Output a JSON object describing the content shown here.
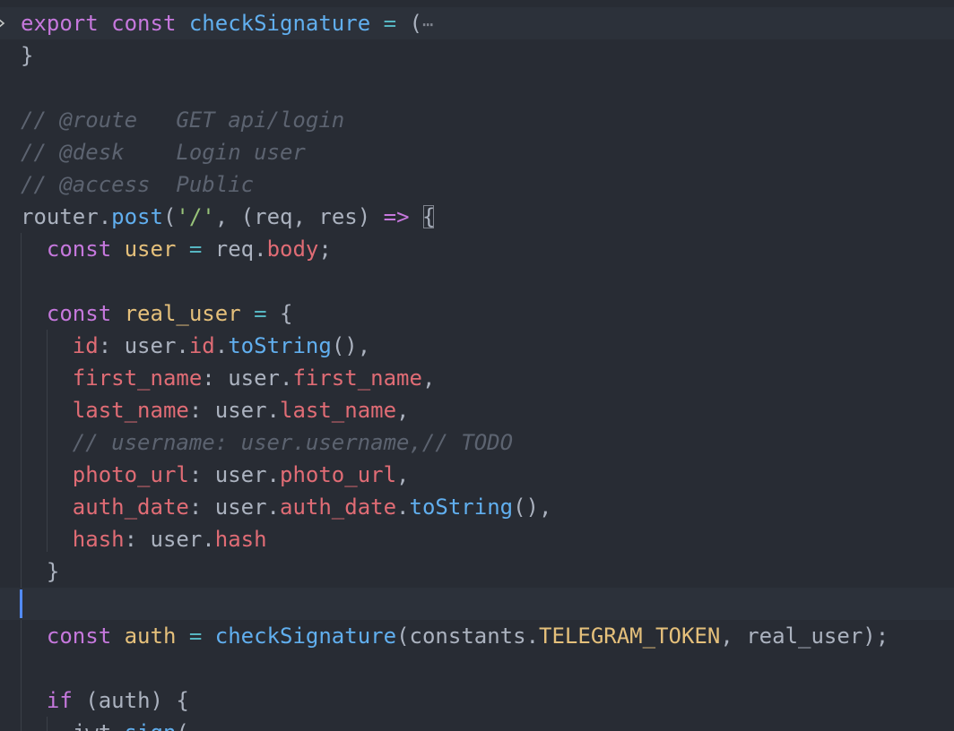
{
  "editor": {
    "lines": [
      {
        "tokens": [
          {
            "t": "export",
            "c": "kw"
          },
          {
            "t": " ",
            "c": "pn"
          },
          {
            "t": "const",
            "c": "kw"
          },
          {
            "t": " ",
            "c": "pn"
          },
          {
            "t": "checkSignature",
            "c": "fn"
          },
          {
            "t": " ",
            "c": "pn"
          },
          {
            "t": "=",
            "c": "op"
          },
          {
            "t": " (",
            "c": "pn"
          }
        ],
        "folded": true
      },
      {
        "tokens": [
          {
            "t": "}",
            "c": "pn"
          }
        ]
      },
      {
        "tokens": []
      },
      {
        "tokens": [
          {
            "t": "// @route   GET api/login",
            "c": "cm"
          }
        ]
      },
      {
        "tokens": [
          {
            "t": "// @desk    Login user",
            "c": "cm"
          }
        ]
      },
      {
        "tokens": [
          {
            "t": "// @access  Public",
            "c": "cm"
          }
        ]
      },
      {
        "tokens": [
          {
            "t": "router",
            "c": "plain"
          },
          {
            "t": ".",
            "c": "pn"
          },
          {
            "t": "post",
            "c": "fn"
          },
          {
            "t": "(",
            "c": "pn"
          },
          {
            "t": "'/'",
            "c": "str"
          },
          {
            "t": ", (",
            "c": "pn"
          },
          {
            "t": "req",
            "c": "plain"
          },
          {
            "t": ", ",
            "c": "pn"
          },
          {
            "t": "res",
            "c": "plain"
          },
          {
            "t": ") ",
            "c": "pn"
          },
          {
            "t": "=>",
            "c": "kw"
          },
          {
            "t": " ",
            "c": "pn"
          },
          {
            "t": "{",
            "c": "pn",
            "match": true
          }
        ]
      },
      {
        "tokens": [
          {
            "t": "  ",
            "c": "pn"
          },
          {
            "t": "const",
            "c": "kw"
          },
          {
            "t": " ",
            "c": "pn"
          },
          {
            "t": "user",
            "c": "var"
          },
          {
            "t": " ",
            "c": "pn"
          },
          {
            "t": "=",
            "c": "op"
          },
          {
            "t": " ",
            "c": "pn"
          },
          {
            "t": "req",
            "c": "plain"
          },
          {
            "t": ".",
            "c": "pn"
          },
          {
            "t": "body",
            "c": "prop"
          },
          {
            "t": ";",
            "c": "pn"
          }
        ]
      },
      {
        "tokens": []
      },
      {
        "tokens": [
          {
            "t": "  ",
            "c": "pn"
          },
          {
            "t": "const",
            "c": "kw"
          },
          {
            "t": " ",
            "c": "pn"
          },
          {
            "t": "real_user",
            "c": "var"
          },
          {
            "t": " ",
            "c": "pn"
          },
          {
            "t": "=",
            "c": "op"
          },
          {
            "t": " {",
            "c": "pn"
          }
        ]
      },
      {
        "tokens": [
          {
            "t": "    ",
            "c": "pn"
          },
          {
            "t": "id",
            "c": "prop"
          },
          {
            "t": ": ",
            "c": "pn"
          },
          {
            "t": "user",
            "c": "plain"
          },
          {
            "t": ".",
            "c": "pn"
          },
          {
            "t": "id",
            "c": "prop"
          },
          {
            "t": ".",
            "c": "pn"
          },
          {
            "t": "toString",
            "c": "fn"
          },
          {
            "t": "(),",
            "c": "pn"
          }
        ]
      },
      {
        "tokens": [
          {
            "t": "    ",
            "c": "pn"
          },
          {
            "t": "first_name",
            "c": "prop"
          },
          {
            "t": ": ",
            "c": "pn"
          },
          {
            "t": "user",
            "c": "plain"
          },
          {
            "t": ".",
            "c": "pn"
          },
          {
            "t": "first_name",
            "c": "prop"
          },
          {
            "t": ",",
            "c": "pn"
          }
        ]
      },
      {
        "tokens": [
          {
            "t": "    ",
            "c": "pn"
          },
          {
            "t": "last_name",
            "c": "prop"
          },
          {
            "t": ": ",
            "c": "pn"
          },
          {
            "t": "user",
            "c": "plain"
          },
          {
            "t": ".",
            "c": "pn"
          },
          {
            "t": "last_name",
            "c": "prop"
          },
          {
            "t": ",",
            "c": "pn"
          }
        ]
      },
      {
        "tokens": [
          {
            "t": "    ",
            "c": "pn"
          },
          {
            "t": "// username: user.username,// TODO",
            "c": "cm"
          }
        ]
      },
      {
        "tokens": [
          {
            "t": "    ",
            "c": "pn"
          },
          {
            "t": "photo_url",
            "c": "prop"
          },
          {
            "t": ": ",
            "c": "pn"
          },
          {
            "t": "user",
            "c": "plain"
          },
          {
            "t": ".",
            "c": "pn"
          },
          {
            "t": "photo_url",
            "c": "prop"
          },
          {
            "t": ",",
            "c": "pn"
          }
        ]
      },
      {
        "tokens": [
          {
            "t": "    ",
            "c": "pn"
          },
          {
            "t": "auth_date",
            "c": "prop"
          },
          {
            "t": ": ",
            "c": "pn"
          },
          {
            "t": "user",
            "c": "plain"
          },
          {
            "t": ".",
            "c": "pn"
          },
          {
            "t": "auth_date",
            "c": "prop"
          },
          {
            "t": ".",
            "c": "pn"
          },
          {
            "t": "toString",
            "c": "fn"
          },
          {
            "t": "(),",
            "c": "pn"
          }
        ]
      },
      {
        "tokens": [
          {
            "t": "    ",
            "c": "pn"
          },
          {
            "t": "hash",
            "c": "prop"
          },
          {
            "t": ": ",
            "c": "pn"
          },
          {
            "t": "user",
            "c": "plain"
          },
          {
            "t": ".",
            "c": "pn"
          },
          {
            "t": "hash",
            "c": "prop"
          }
        ]
      },
      {
        "tokens": [
          {
            "t": "  }",
            "c": "pn"
          }
        ]
      },
      {
        "tokens": [],
        "current": true
      },
      {
        "tokens": [
          {
            "t": "  ",
            "c": "pn"
          },
          {
            "t": "const",
            "c": "kw"
          },
          {
            "t": " ",
            "c": "pn"
          },
          {
            "t": "auth",
            "c": "var"
          },
          {
            "t": " ",
            "c": "pn"
          },
          {
            "t": "=",
            "c": "op"
          },
          {
            "t": " ",
            "c": "pn"
          },
          {
            "t": "checkSignature",
            "c": "fn"
          },
          {
            "t": "(",
            "c": "pn"
          },
          {
            "t": "constants",
            "c": "plain"
          },
          {
            "t": ".",
            "c": "pn"
          },
          {
            "t": "TELEGRAM_TOKEN",
            "c": "var"
          },
          {
            "t": ", ",
            "c": "pn"
          },
          {
            "t": "real_user",
            "c": "plain"
          },
          {
            "t": ");",
            "c": "pn"
          }
        ]
      },
      {
        "tokens": []
      },
      {
        "tokens": [
          {
            "t": "  ",
            "c": "pn"
          },
          {
            "t": "if",
            "c": "kw"
          },
          {
            "t": " (",
            "c": "pn"
          },
          {
            "t": "auth",
            "c": "plain"
          },
          {
            "t": ") {",
            "c": "pn"
          }
        ]
      },
      {
        "tokens": [
          {
            "t": "    ",
            "c": "pn"
          },
          {
            "t": "jwt",
            "c": "plain"
          },
          {
            "t": ".",
            "c": "pn"
          },
          {
            "t": "sign",
            "c": "fn"
          },
          {
            "t": "(",
            "c": "pn"
          }
        ]
      }
    ],
    "fold_ellipsis": "⋯",
    "fold_marker_icon": "chevron-right-icon"
  }
}
